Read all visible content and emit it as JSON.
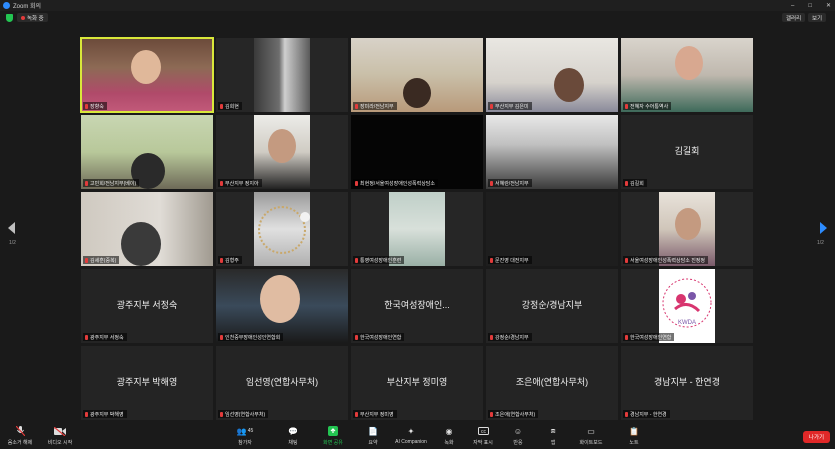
{
  "window": {
    "title": "Zoom 회의",
    "controls": [
      "–",
      "□",
      "✕"
    ]
  },
  "infobar": {
    "recording_label": "녹화 중",
    "view_label": "보기",
    "fullscreen_label": "갤러리"
  },
  "tiles": [
    {
      "name": "장향숙",
      "show_big": false,
      "active": true
    },
    {
      "name": "김희현",
      "show_big": false
    },
    {
      "name": "장미라/전남지부",
      "show_big": false
    },
    {
      "name": "부산지부 김은미",
      "show_big": false
    },
    {
      "name": "전혜자 수어통역사",
      "show_big": false
    },
    {
      "name": "고민희/전남지부(베이)",
      "show_big": false
    },
    {
      "name": "부산지부 정지아",
      "show_big": false
    },
    {
      "name": "최현정/서울여성장애인성폭력상담소",
      "show_big": false
    },
    {
      "name": "서혜란/전남지부",
      "show_big": false
    },
    {
      "name": "김길회",
      "show_big": true
    },
    {
      "name": "김세훈(중복)",
      "show_big": false
    },
    {
      "name": "김형주",
      "show_big": false
    },
    {
      "name": "통영여성장애인훈련",
      "show_big": false
    },
    {
      "name": "문진영 대전지부",
      "show_big": false
    },
    {
      "name": "서울여성장애인성폭력상담소 진정정",
      "show_big": false
    },
    {
      "name": "광주지부 서정숙",
      "show_big": true
    },
    {
      "name": "인천중부장애인성인연합회",
      "show_big": false
    },
    {
      "name": "한국여성장애인연합",
      "show_big": true,
      "big_name": "한국여성장애인..."
    },
    {
      "name": "강정순/경남지부",
      "show_big": true
    },
    {
      "name": "한국여성장애인연합",
      "show_big": false,
      "logo_text": "KWDA"
    },
    {
      "name": "광주지부 박해영",
      "show_big": true
    },
    {
      "name": "임선영(연합사무처)",
      "show_big": true
    },
    {
      "name": "부산지부 정미영",
      "show_big": true
    },
    {
      "name": "조은애(연합사무처)",
      "show_big": true
    },
    {
      "name": "경남지부 - 한연경",
      "show_big": true
    }
  ],
  "pagination": {
    "left": "1/2",
    "right": "1/2"
  },
  "toolbar": {
    "items": [
      {
        "label": "음소거 해제",
        "icon": "mic-off-icon"
      },
      {
        "label": "비디오 시작",
        "icon": "video-off-icon"
      },
      {
        "label": "참가자",
        "icon": "participants-icon",
        "count": "45"
      },
      {
        "label": "채팅",
        "icon": "chat-icon"
      },
      {
        "label": "화면 공유",
        "icon": "share-screen-icon"
      },
      {
        "label": "요약",
        "icon": "summary-icon"
      },
      {
        "label": "AI Companion",
        "icon": "ai-companion-icon"
      },
      {
        "label": "녹화",
        "icon": "record-icon"
      },
      {
        "label": "자막 표시",
        "icon": "captions-icon"
      },
      {
        "label": "반응",
        "icon": "reactions-icon"
      },
      {
        "label": "앱",
        "icon": "apps-icon"
      },
      {
        "label": "화이트보드",
        "icon": "whiteboard-icon"
      },
      {
        "label": "노트",
        "icon": "notes-icon"
      }
    ],
    "leave_label": "나가기"
  },
  "colors": {
    "active_speaker": "#d9e83a",
    "share_green": "#23c552",
    "leave_red": "#e02828",
    "accent_blue": "#2d8cff"
  }
}
